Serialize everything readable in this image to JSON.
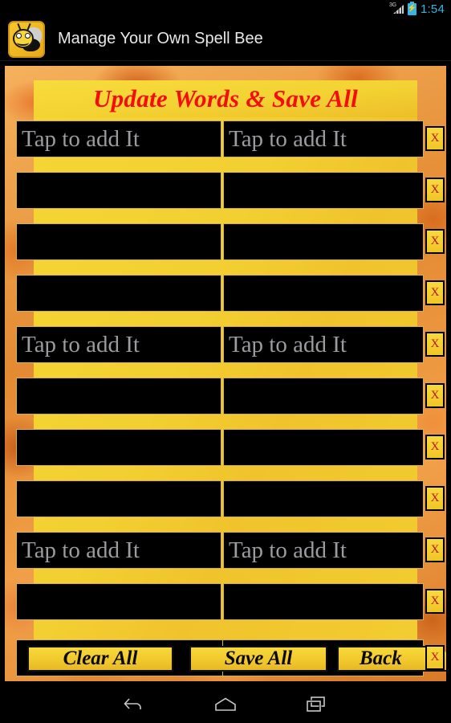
{
  "status_bar": {
    "network_label": "3G",
    "clock": "1:54",
    "signal_icon": "signal-3g-icon",
    "battery_icon": "battery-charging-icon",
    "accent_color": "#33b5e5"
  },
  "action_bar": {
    "app_icon": "bee-app-icon",
    "title": "Manage Your Own Spell Bee"
  },
  "screen": {
    "heading": "Update Words & Save All",
    "heading_color": "#f50d0d",
    "panel_color": "#f3cf31",
    "field_background": "#000000",
    "hint_color": "#9b9ba0",
    "placeholder": "Tap to add It",
    "remove_label": "X",
    "remove_label_color": "#c0131a",
    "rows": [
      {
        "left_value": "",
        "right_value": "",
        "left_placeholder": "Tap to add It",
        "right_placeholder": "Tap to add It",
        "show_placeholder": true,
        "remove": "X"
      },
      {
        "left_value": "",
        "right_value": "",
        "left_placeholder": "",
        "right_placeholder": "",
        "show_placeholder": false,
        "remove": "X"
      },
      {
        "left_value": "",
        "right_value": "",
        "left_placeholder": "",
        "right_placeholder": "",
        "show_placeholder": false,
        "remove": "X"
      },
      {
        "left_value": "",
        "right_value": "",
        "left_placeholder": "",
        "right_placeholder": "",
        "show_placeholder": false,
        "remove": "X"
      },
      {
        "left_value": "",
        "right_value": "",
        "left_placeholder": "Tap to add It",
        "right_placeholder": "Tap to add It",
        "show_placeholder": true,
        "remove": "X"
      },
      {
        "left_value": "",
        "right_value": "",
        "left_placeholder": "",
        "right_placeholder": "",
        "show_placeholder": false,
        "remove": "X"
      },
      {
        "left_value": "",
        "right_value": "",
        "left_placeholder": "",
        "right_placeholder": "",
        "show_placeholder": false,
        "remove": "X"
      },
      {
        "left_value": "",
        "right_value": "",
        "left_placeholder": "",
        "right_placeholder": "",
        "show_placeholder": false,
        "remove": "X"
      },
      {
        "left_value": "",
        "right_value": "",
        "left_placeholder": "Tap to add It",
        "right_placeholder": "Tap to add It",
        "show_placeholder": true,
        "remove": "X"
      },
      {
        "left_value": "",
        "right_value": "",
        "left_placeholder": "",
        "right_placeholder": "",
        "show_placeholder": false,
        "remove": "X"
      }
    ],
    "buttons": {
      "clear_all": "Clear All",
      "save_all": "Save All",
      "back": "Back",
      "bottom_remove": "X"
    }
  },
  "nav_bar": {
    "back": "back-icon",
    "home": "home-icon",
    "recents": "recents-icon"
  }
}
